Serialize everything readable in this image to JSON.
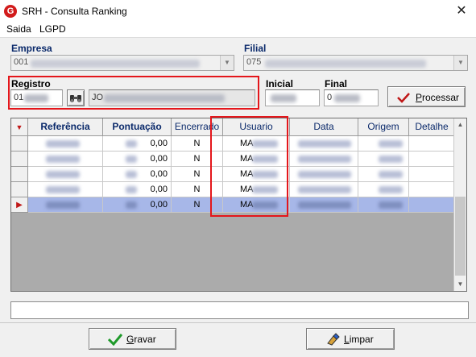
{
  "window": {
    "title": "SRH - Consulta Ranking",
    "close_glyph": "✕",
    "app_icon_letter": "G"
  },
  "menu": {
    "items": [
      "Saida",
      "LGPD"
    ]
  },
  "empresa": {
    "label": "Empresa",
    "value": "001"
  },
  "filial": {
    "label": "Filial",
    "value": "075"
  },
  "registro": {
    "label": "Registro",
    "code": "01",
    "name": "JO"
  },
  "inicial": {
    "label": "Inicial"
  },
  "final": {
    "label": "Final",
    "value": "0"
  },
  "buttons": {
    "processar": "Processar",
    "gravar": "Gravar",
    "limpar": "Limpar"
  },
  "grid": {
    "columns": [
      "Referência",
      "Pontuação",
      "Encerrado",
      "Usuario",
      "Data",
      "Origem",
      "Detalhe"
    ],
    "rows": [
      {
        "pontuacao": "0,00",
        "encerrado": "N",
        "usuario": "MA"
      },
      {
        "pontuacao": "0,00",
        "encerrado": "N",
        "usuario": "MA"
      },
      {
        "pontuacao": "0,00",
        "encerrado": "N",
        "usuario": "MA"
      },
      {
        "pontuacao": "0,00",
        "encerrado": "N",
        "usuario": "MA"
      },
      {
        "pontuacao": "0,00",
        "encerrado": "N",
        "usuario": "MA"
      }
    ],
    "selected_row": 5
  },
  "colors": {
    "accent_label": "#0b2a6b",
    "highlight": "#e4161b",
    "selection": "#a7b7e8",
    "check": "#1e9a2a"
  }
}
